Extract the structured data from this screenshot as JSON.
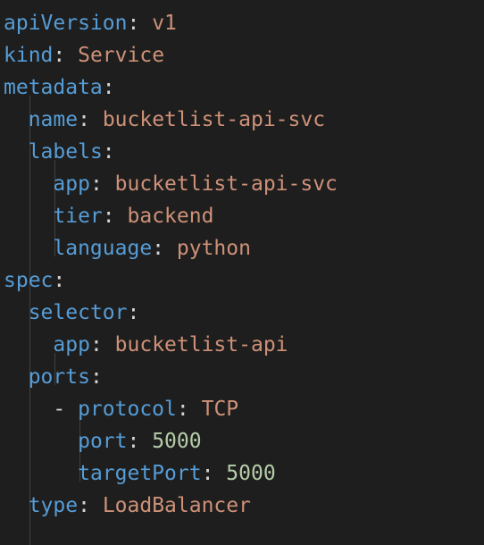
{
  "lines": [
    {
      "indent": 0,
      "key": "apiVersion",
      "value": "v1",
      "vtype": "str"
    },
    {
      "indent": 0,
      "key": "kind",
      "value": "Service",
      "vtype": "str"
    },
    {
      "indent": 0,
      "key": "metadata",
      "value": "",
      "vtype": "str"
    },
    {
      "indent": 1,
      "key": "name",
      "value": "bucketlist-api-svc",
      "vtype": "str"
    },
    {
      "indent": 1,
      "key": "labels",
      "value": "",
      "vtype": "str"
    },
    {
      "indent": 2,
      "key": "app",
      "value": "bucketlist-api-svc",
      "vtype": "str"
    },
    {
      "indent": 2,
      "key": "tier",
      "value": "backend",
      "vtype": "str"
    },
    {
      "indent": 2,
      "key": "language",
      "value": "python",
      "vtype": "str"
    },
    {
      "indent": 0,
      "key": "spec",
      "value": "",
      "vtype": "str"
    },
    {
      "indent": 1,
      "key": "selector",
      "value": "",
      "vtype": "str"
    },
    {
      "indent": 2,
      "key": "app",
      "value": "bucketlist-api",
      "vtype": "str"
    },
    {
      "indent": 1,
      "key": "ports",
      "value": "",
      "vtype": "str"
    },
    {
      "indent": 2,
      "dash": true,
      "key": "protocol",
      "value": "TCP",
      "vtype": "str"
    },
    {
      "indent": 3,
      "key": "port",
      "value": "5000",
      "vtype": "num"
    },
    {
      "indent": 3,
      "key": "targetPort",
      "value": "5000",
      "vtype": "num"
    },
    {
      "indent": 1,
      "key": "type",
      "value": "LoadBalancer",
      "vtype": "str"
    }
  ],
  "colors": {
    "background": "#1e1e1e",
    "key": "#569cd6",
    "string": "#ce9178",
    "number": "#b5cea8",
    "punctuation": "#d4d4d4",
    "indent_guide": "#404040"
  }
}
